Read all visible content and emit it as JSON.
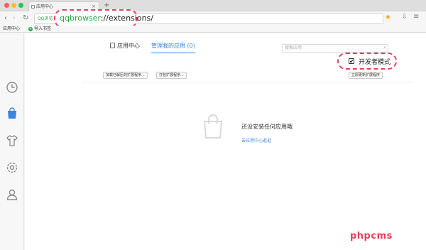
{
  "browser": {
    "tab_title": "应用中心",
    "tab_close": "×",
    "new_tab": "+",
    "nav": {
      "back": "‹",
      "forward": "›",
      "reload": "↻"
    },
    "address_prefix": "QQ浏览",
    "url_scheme": "qqbrowser",
    "url_rest": "://extensions/",
    "star": "★",
    "download": "⇩",
    "menu": "≡"
  },
  "bookmarks": [
    {
      "label": "应用中心"
    },
    {
      "label": "导入书签",
      "icon": "+"
    }
  ],
  "sidebar": {
    "items": [
      {
        "icon": "clock-icon"
      },
      {
        "icon": "bag-icon",
        "active": true
      },
      {
        "icon": "shirt-icon"
      },
      {
        "icon": "gear-icon"
      },
      {
        "icon": "user-icon"
      }
    ]
  },
  "main": {
    "tabs": [
      {
        "label": "应用中心"
      },
      {
        "label": "管理我的应用 (0)",
        "active": true
      }
    ],
    "search_placeholder": "搜索应用",
    "search_icon": "⌕",
    "developer_mode": {
      "label": "开发者模式",
      "checked": true,
      "check_mark": "✔"
    },
    "buttons": {
      "load_unpacked": "加载已解压的扩展程序...",
      "pack": "打包扩展程序...",
      "update": "立即更新扩展程序"
    },
    "empty_state": {
      "message": "还没安装任何应用哦",
      "link": "去应用中心逛逛"
    }
  },
  "watermark": "phpcms",
  "colors": {
    "accent": "#3a86d9",
    "highlight": "#e8405b",
    "green": "#2ea44f"
  }
}
